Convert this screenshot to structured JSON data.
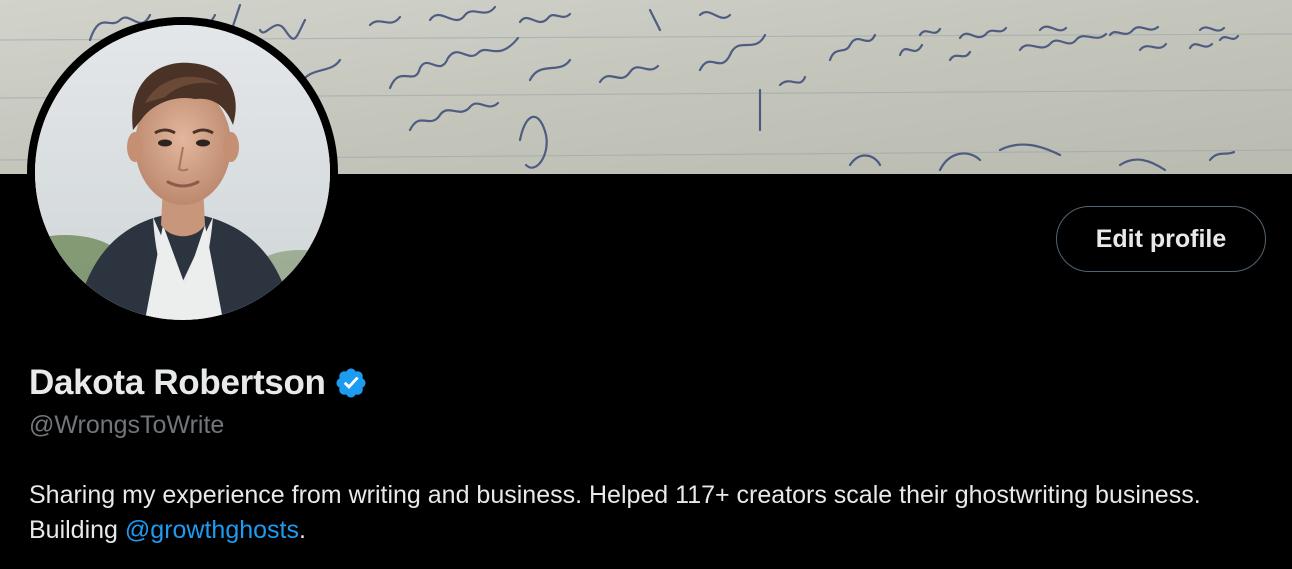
{
  "banner": {
    "description_icon": "handwritten-note-banner"
  },
  "avatar": {
    "icon": "profile-photo"
  },
  "actions": {
    "edit_profile_label": "Edit profile"
  },
  "profile": {
    "display_name": "Dakota Robertson",
    "verified": true,
    "handle": "@WrongsToWrite",
    "bio_text": "Sharing my experience from writing and business. Helped 117+ creators scale their ghostwriting business. Building ",
    "bio_mention": "@growthghosts",
    "bio_suffix": "."
  },
  "colors": {
    "background": "#000000",
    "text_primary": "#e7e9ea",
    "text_secondary": "#71767b",
    "link": "#1d9bf0",
    "verified_badge": "#1d9bf0",
    "button_border": "#536471"
  }
}
